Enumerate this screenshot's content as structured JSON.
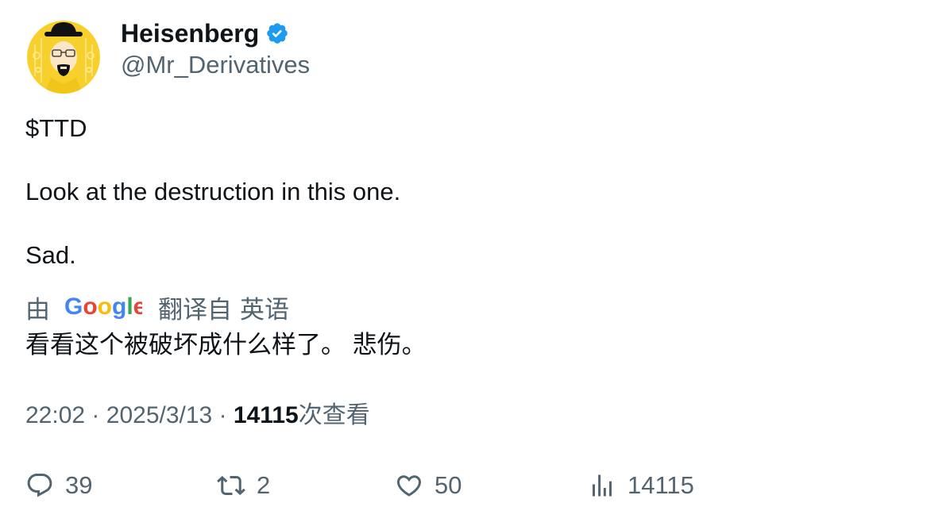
{
  "author": {
    "name": "Heisenberg",
    "handle": "@Mr_Derivatives",
    "verified": true,
    "verified_color": "#1d9bf0"
  },
  "tweet": {
    "lines": [
      "$TTD",
      "Look at the destruction in this one.",
      "Sad."
    ]
  },
  "translation": {
    "by_label": "由",
    "provider": "Google",
    "translated_from_label": "翻译自",
    "source_language": "英语",
    "text": "看看这个被破坏成什么样了。 悲伤。"
  },
  "meta": {
    "time": "22:02",
    "separator": "·",
    "date": "2025/3/13",
    "views_count": "14115",
    "views_label": "次查看"
  },
  "actions": {
    "replies": "39",
    "retweets": "2",
    "likes": "50",
    "views": "14115"
  },
  "colors": {
    "text_primary": "#0f1419",
    "text_secondary": "#536471",
    "avatar_bg": "#f7d02c",
    "google_blue": "#4285F4",
    "google_red": "#EA4335",
    "google_yellow": "#FBBC05",
    "google_green": "#34A853"
  }
}
